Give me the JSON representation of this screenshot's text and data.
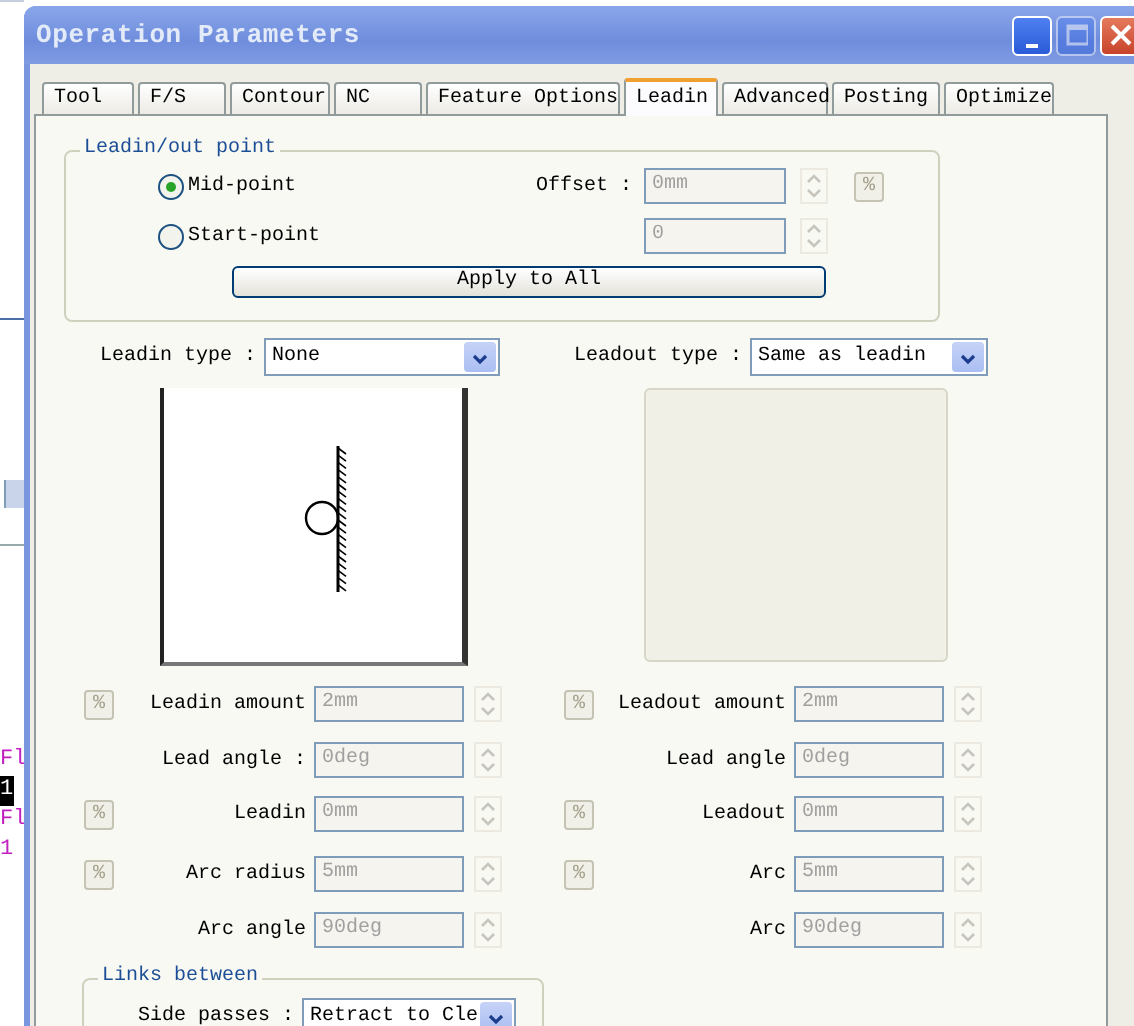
{
  "background_fragments": [
    {
      "text": "Fl",
      "highlighted": false
    },
    {
      "text": "1",
      "highlighted": true
    },
    {
      "text": "Fl",
      "highlighted": false
    },
    {
      "text": "1",
      "highlighted": false
    }
  ],
  "window": {
    "title": "Operation Parameters",
    "buttons": [
      {
        "kind": "minimize",
        "disabled": false
      },
      {
        "kind": "maximize",
        "disabled": true
      },
      {
        "kind": "close",
        "disabled": false
      }
    ]
  },
  "tabs": [
    {
      "label": "Tool",
      "selected": false
    },
    {
      "label": "F/S",
      "selected": false
    },
    {
      "label": "Contour",
      "selected": false
    },
    {
      "label": "NC",
      "selected": false
    },
    {
      "label": "Feature Options",
      "selected": false
    },
    {
      "label": "Leadin",
      "selected": true
    },
    {
      "label": "Advanced",
      "selected": false
    },
    {
      "label": "Posting",
      "selected": false
    },
    {
      "label": "Optimize",
      "selected": false
    }
  ],
  "leadin_point": {
    "title": "Leadin/out point",
    "options": [
      {
        "label": "Mid-point",
        "selected": true
      },
      {
        "label": "Start-point",
        "selected": false
      }
    ],
    "offset": {
      "label": "Offset :",
      "value": "0mm",
      "disabled": true,
      "percent": "%"
    },
    "offset_2": {
      "value": "0",
      "disabled": true
    },
    "apply_button": "Apply to All"
  },
  "leadin_type": {
    "label": "Leadin type :",
    "value": "None"
  },
  "leadout_type": {
    "label": "Leadout type :",
    "value": "Same as leadin"
  },
  "previews": [
    {
      "kind": "picture",
      "disabled": false
    },
    {
      "kind": "empty",
      "disabled": true
    }
  ],
  "leadin_fields": [
    {
      "label": "Leadin amount",
      "value": "2mm",
      "disabled": true,
      "percent": "%"
    },
    {
      "label": "Lead angle :",
      "value": "0deg",
      "disabled": true
    },
    {
      "label": "Leadin",
      "value": "0mm",
      "disabled": true,
      "percent": "%"
    },
    {
      "label": "Arc radius",
      "value": "5mm",
      "disabled": true,
      "percent": "%"
    },
    {
      "label": "Arc angle",
      "value": "90deg",
      "disabled": true
    }
  ],
  "leadout_fields": [
    {
      "label": "Leadout amount",
      "value": "2mm",
      "disabled": true,
      "percent": "%"
    },
    {
      "label": "Lead angle",
      "value": "0deg",
      "disabled": true
    },
    {
      "label": "Leadout",
      "value": "0mm",
      "disabled": true,
      "percent": "%"
    },
    {
      "label": "Arc",
      "value": "5mm",
      "disabled": true,
      "percent": "%"
    },
    {
      "label": "Arc",
      "value": "90deg",
      "disabled": true
    }
  ],
  "links": {
    "title": "Links between",
    "side_passes": {
      "label": "Side passes :",
      "value": "Retract to Cle"
    }
  }
}
